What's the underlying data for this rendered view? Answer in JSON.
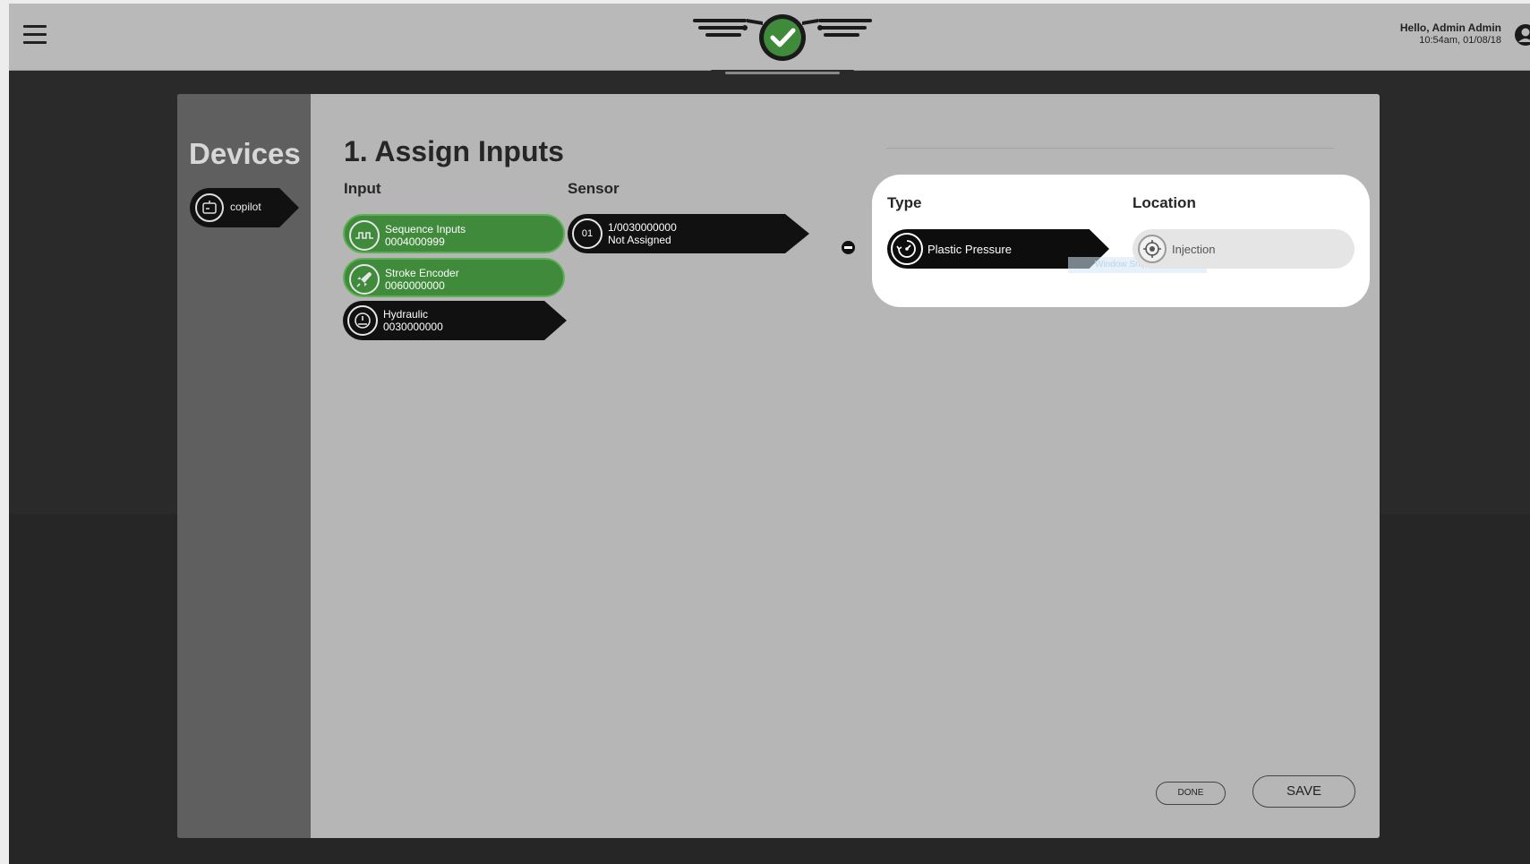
{
  "header": {
    "greeting": "Hello, Admin Admin",
    "timestamp": "10:54am, 01/08/18",
    "menu_icon": "hamburger-icon",
    "logo_icon": "winged-checkmark-logo",
    "user_icon": "user-icon"
  },
  "sidebar": {
    "title": "Devices",
    "items": [
      {
        "label": "copilot",
        "icon": "device-icon",
        "selected": true
      }
    ]
  },
  "main": {
    "title": "1. Assign Inputs",
    "columns": {
      "input": "Input",
      "sensor": "Sensor",
      "type": "Type",
      "location": "Location"
    },
    "inputs": [
      {
        "name": "Sequence Inputs",
        "code": "0004000999",
        "icon": "pulse-wave-icon",
        "state": "assigned"
      },
      {
        "name": "Stroke Encoder",
        "code": "0060000000",
        "icon": "rocket-icon",
        "state": "assigned"
      },
      {
        "name": "Hydraulic",
        "code": "0030000000",
        "icon": "gauge-icon",
        "state": "selected"
      }
    ],
    "sensor": {
      "number": "01",
      "id": "1/0030000000",
      "status": "Not Assigned"
    },
    "type": {
      "label": "Plastic Pressure",
      "icon": "pressure-gauge-icon"
    },
    "location": {
      "label": "Injection",
      "icon": "target-icon"
    },
    "overlay_text": "Window Snip"
  },
  "footer": {
    "done_label": "DONE",
    "save_label": "SAVE"
  },
  "colors": {
    "accent_green": "#3f8a3b",
    "pill_dark": "#111111",
    "panel_bg": "#b6b6b6",
    "sidebar_bg": "#5f5f5f",
    "topbar_bg": "#b9b9b9"
  }
}
